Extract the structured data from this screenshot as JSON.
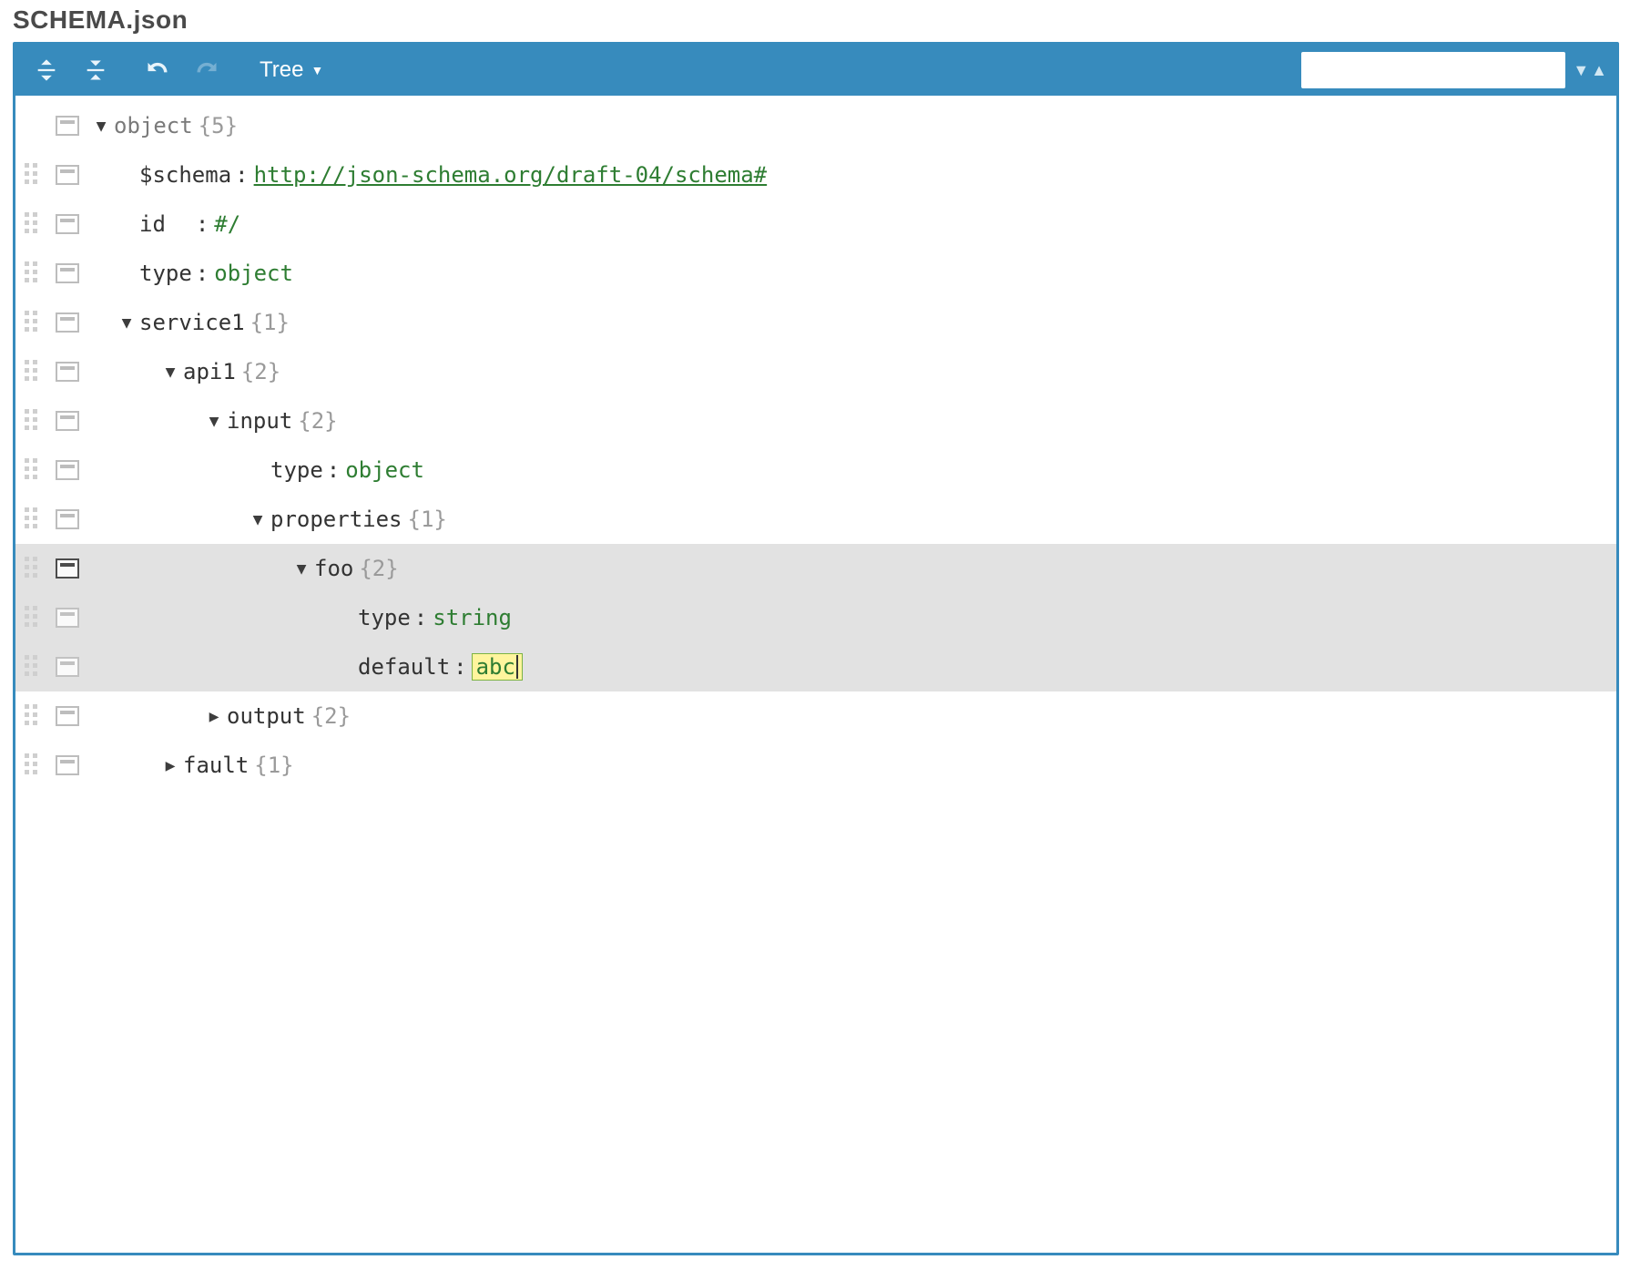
{
  "title": "SCHEMA.json",
  "toolbar": {
    "mode_label": "Tree"
  },
  "search": {
    "placeholder": ""
  },
  "colors": {
    "toolbar": "#378bbd",
    "string": "#2e7d32",
    "highlight": "#fff59d"
  },
  "tree": {
    "root": {
      "label": "object",
      "count": "{5}"
    },
    "rows": [
      {
        "key": "$schema",
        "value": "http://json-schema.org/draft-04/schema#",
        "link": true
      },
      {
        "key": "id",
        "value": "#/",
        "pad_key": true
      },
      {
        "key": "type",
        "value": "object"
      }
    ],
    "service1": {
      "key": "service1",
      "count": "{1}"
    },
    "api1": {
      "key": "api1",
      "count": "{2}"
    },
    "input": {
      "key": "input",
      "count": "{2}"
    },
    "input_type": {
      "key": "type",
      "value": "object"
    },
    "properties": {
      "key": "properties",
      "count": "{1}"
    },
    "foo": {
      "key": "foo",
      "count": "{2}"
    },
    "foo_type": {
      "key": "type",
      "value": "string"
    },
    "foo_default": {
      "key": "default",
      "value": "abc"
    },
    "output": {
      "key": "output",
      "count": "{2}"
    },
    "fault": {
      "key": "fault",
      "count": "{1}"
    }
  }
}
